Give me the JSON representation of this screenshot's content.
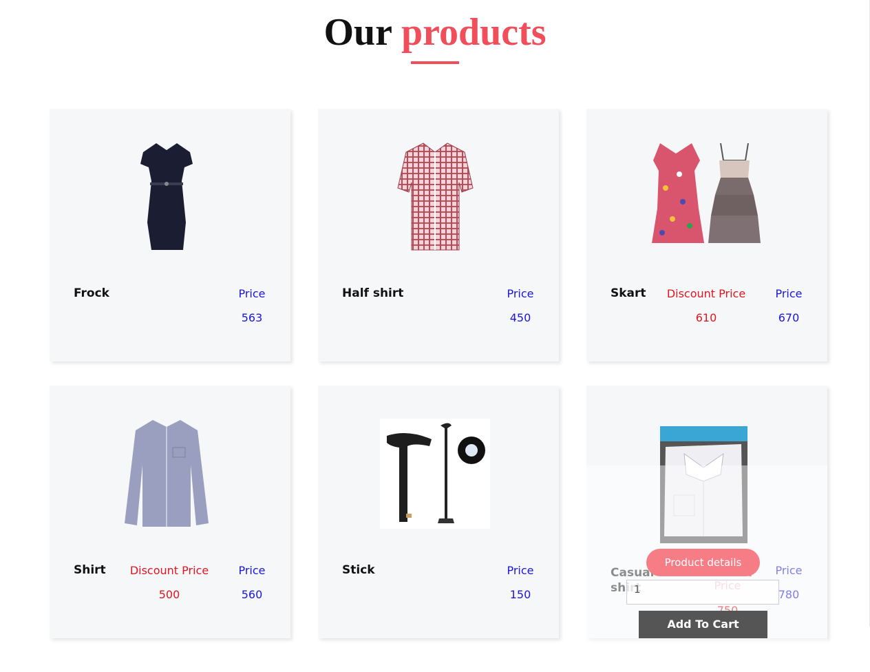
{
  "section": {
    "title_main": "Our",
    "title_accent": "products"
  },
  "products": [
    {
      "name": "Frock",
      "price_label": "Price",
      "price": "563"
    },
    {
      "name": "Half shirt",
      "price_label": "Price",
      "price": "450"
    },
    {
      "name": "Skart",
      "discount_label": "Discount Price",
      "discount_price": "610",
      "price_label": "Price",
      "price": "670"
    },
    {
      "name": "Shirt",
      "discount_label": "Discount Price",
      "discount_price": "500",
      "price_label": "Price",
      "price": "560"
    },
    {
      "name": "Stick",
      "price_label": "Price",
      "price": "150"
    },
    {
      "name": "Casual shirt",
      "discount_label": "Discount Price",
      "discount_price": "750",
      "price_label": "Price",
      "price": "780",
      "hover": {
        "details_button": "Product details",
        "quantity_value": "1",
        "add_button": "Add To Cart"
      }
    }
  ],
  "colors": {
    "accent": "#f04e5b",
    "price": "#1b16d6",
    "discount": "#e0151e",
    "card_bg": "#f6f7f9"
  }
}
